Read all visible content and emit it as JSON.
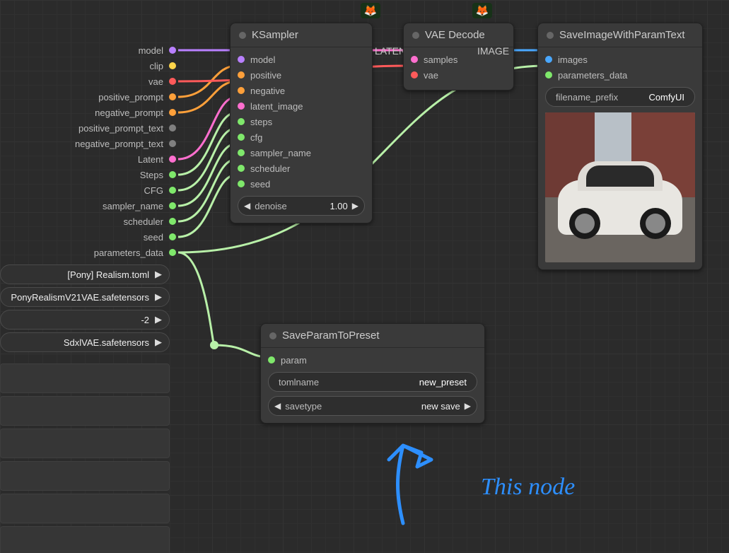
{
  "fox_emoji": "🦊",
  "left_panel": {
    "outputs": [
      {
        "label": "model",
        "color": "#b980ff"
      },
      {
        "label": "clip",
        "color": "#ffd54a"
      },
      {
        "label": "vae",
        "color": "#ff5a5a"
      },
      {
        "label": "positive_prompt",
        "color": "#ffa03a"
      },
      {
        "label": "negative_prompt",
        "color": "#ffa03a"
      },
      {
        "label": "positive_prompt_text",
        "color": "#808080"
      },
      {
        "label": "negative_prompt_text",
        "color": "#808080"
      },
      {
        "label": "Latent",
        "color": "#ff6fcf"
      },
      {
        "label": "Steps",
        "color": "#7fe86b"
      },
      {
        "label": "CFG",
        "color": "#7fe86b"
      },
      {
        "label": "sampler_name",
        "color": "#7fe86b"
      },
      {
        "label": "scheduler",
        "color": "#7fe86b"
      },
      {
        "label": "seed",
        "color": "#7fe86b"
      },
      {
        "label": "parameters_data",
        "color": "#7fe86b"
      }
    ],
    "widgets": [
      "[Pony] Realism.toml",
      "PonyRealismV21VAE.safetensors",
      "-2",
      "SdxlVAE.safetensors"
    ]
  },
  "ksampler": {
    "title": "KSampler",
    "inputs": [
      {
        "label": "model",
        "color": "#b980ff"
      },
      {
        "label": "positive",
        "color": "#ffa03a"
      },
      {
        "label": "negative",
        "color": "#ffa03a"
      },
      {
        "label": "latent_image",
        "color": "#ff6fcf"
      },
      {
        "label": "steps",
        "color": "#7fe86b"
      },
      {
        "label": "cfg",
        "color": "#7fe86b"
      },
      {
        "label": "sampler_name",
        "color": "#7fe86b"
      },
      {
        "label": "scheduler",
        "color": "#7fe86b"
      },
      {
        "label": "seed",
        "color": "#7fe86b"
      }
    ],
    "output_label": "LATENT",
    "denoise_label": "denoise",
    "denoise_value": "1.00"
  },
  "vae_decode": {
    "title": "VAE Decode",
    "inputs": [
      {
        "label": "samples",
        "color": "#ff6fcf"
      },
      {
        "label": "vae",
        "color": "#ff5a5a"
      }
    ],
    "output_label": "IMAGE"
  },
  "save_image": {
    "title": "SaveImageWithParamText",
    "inputs": [
      {
        "label": "images",
        "color": "#4aa8ff"
      },
      {
        "label": "parameters_data",
        "color": "#7fe86b"
      }
    ],
    "filename_prefix_label": "filename_prefix",
    "filename_prefix_value": "ComfyUI"
  },
  "save_preset": {
    "title": "SaveParamToPreset",
    "input": {
      "label": "param",
      "color": "#7fe86b"
    },
    "tomlname_label": "tomlname",
    "tomlname_value": "new_preset",
    "savetype_label": "savetype",
    "savetype_value": "new save"
  },
  "annotation": "This node"
}
